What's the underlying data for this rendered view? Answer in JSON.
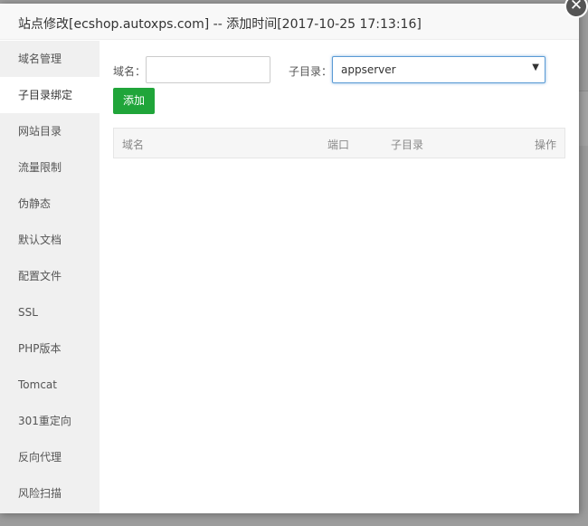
{
  "dialog": {
    "title": "站点修改[ecshop.autoxps.com] -- 添加时间[2017-10-25 17:13:16]",
    "close_icon": "✕"
  },
  "sidebar": {
    "items": [
      {
        "label": "域名管理"
      },
      {
        "label": "子目录绑定"
      },
      {
        "label": "网站目录"
      },
      {
        "label": "流量限制"
      },
      {
        "label": "伪静态"
      },
      {
        "label": "默认文档"
      },
      {
        "label": "配置文件"
      },
      {
        "label": "SSL"
      },
      {
        "label": "PHP版本"
      },
      {
        "label": "Tomcat"
      },
      {
        "label": "301重定向"
      },
      {
        "label": "反向代理"
      },
      {
        "label": "风险扫描"
      }
    ],
    "active_index": 1
  },
  "form": {
    "domain_label": "域名：",
    "domain_value": "",
    "subdir_label": "子目录：",
    "subdir_value": "appserver",
    "add_button": "添加"
  },
  "table": {
    "columns": [
      "域名",
      "端口",
      "子目录",
      "操作"
    ],
    "rows": []
  },
  "colors": {
    "accent_green": "#20a53a",
    "focus_blue": "#5b9bd5"
  }
}
